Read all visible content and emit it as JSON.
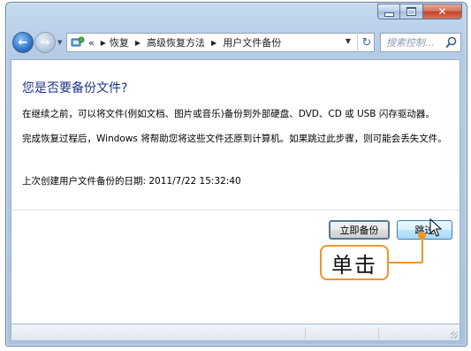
{
  "window": {
    "caption_buttons": {
      "min": "minimize",
      "max": "maximize",
      "close": "close"
    }
  },
  "nav": {
    "back_icon": "back-arrow-icon",
    "forward_icon": "forward-arrow-icon",
    "overflow": "«",
    "breadcrumb": [
      "恢复",
      "高级恢复方法",
      "用户文件备份"
    ],
    "search_placeholder": "搜索控制..."
  },
  "content": {
    "title": "您是否要备份文件?",
    "paragraph1": "在继续之前，可以将文件(例如文档、图片或音乐)备份到外部硬盘、DVD、CD 或 USB 闪存驱动器。",
    "paragraph2": "完成恢复过程后，Windows 将帮助您将这些文件还原到计算机。如果跳过此步骤，则可能会丢失文件。",
    "last_backup": "上次创建用户文件备份的日期: 2011/7/22 15:32:40"
  },
  "buttons": {
    "backup_now": "立即备份",
    "skip": "跳过"
  },
  "annotation": {
    "label": "单击",
    "color": "#f0962b"
  },
  "colors": {
    "title": "#1e3287",
    "frame": "#b4cbe6",
    "close": "#c4422a"
  }
}
